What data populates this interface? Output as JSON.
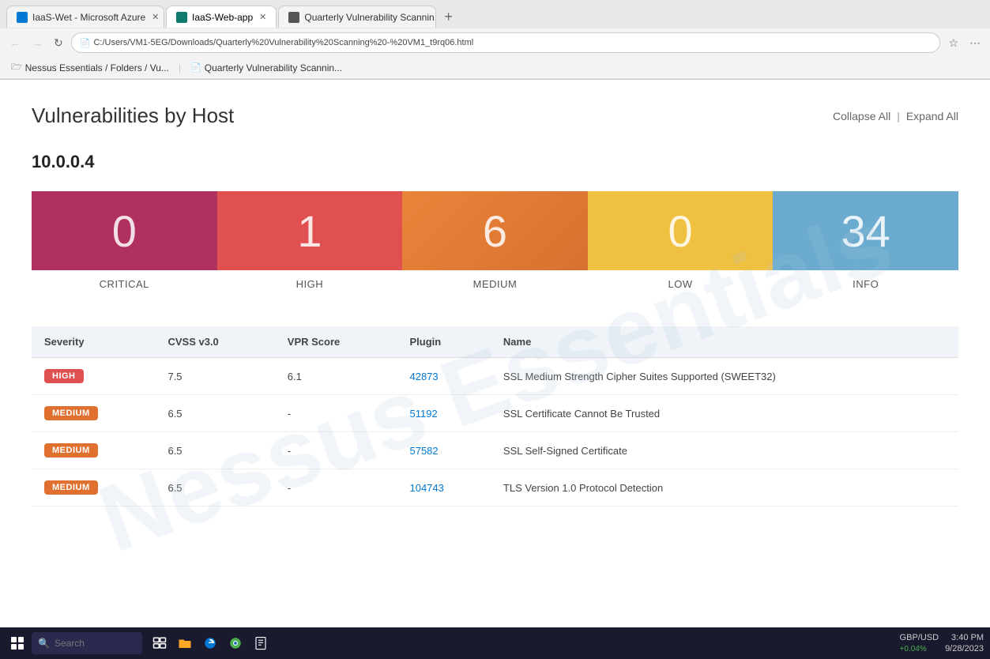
{
  "browser": {
    "tabs": [
      {
        "id": 1,
        "label": "IaaS-Wet - Microsoft Azure",
        "active": false,
        "icon": "azure"
      },
      {
        "id": 2,
        "label": "IaaS-Web-app",
        "active": true,
        "icon": "edge"
      },
      {
        "id": 3,
        "label": "Quarterly Vulnerability Scannin...",
        "active": false,
        "icon": "file"
      }
    ],
    "url": "C:/Users/VM1-5EG/Downloads/Quarterly%20Vulnerability%20Scanning%20-%20VM1_t9rq06.html",
    "url_display": "C:/Users/VM1-5EG/Downloads/Quarterly%20Vulnerability%20Scanning%20-%20VM1_t9rq06.html",
    "bookmarks": [
      {
        "label": "Nessus Essentials / Folders / Vu...",
        "icon": "🗁"
      },
      {
        "label": "Quarterly Vulnerability Scannin...",
        "icon": "📄"
      }
    ]
  },
  "page": {
    "title": "Vulnerabilities by Host",
    "collapse_all": "Collapse All",
    "expand_all": "Expand All",
    "separator": "|",
    "watermark": "Nessus Ess..."
  },
  "host": {
    "ip": "10.0.0.4"
  },
  "severity_cards": [
    {
      "id": "critical",
      "count": "0",
      "label": "CRITICAL",
      "class": "card-critical"
    },
    {
      "id": "high",
      "count": "1",
      "label": "HIGH",
      "class": "card-high"
    },
    {
      "id": "medium",
      "count": "6",
      "label": "MEDIUM",
      "class": "card-medium"
    },
    {
      "id": "low",
      "count": "0",
      "label": "LOW",
      "class": "card-low"
    },
    {
      "id": "info",
      "count": "34",
      "label": "INFO",
      "class": "card-info"
    }
  ],
  "table": {
    "headers": [
      "Severity",
      "CVSS v3.0",
      "VPR Score",
      "Plugin",
      "Name"
    ],
    "rows": [
      {
        "severity": "HIGH",
        "severity_class": "badge-high",
        "cvss": "7.5",
        "vpr": "6.1",
        "plugin": "42873",
        "name": "SSL Medium Strength Cipher Suites Supported (SWEET32)"
      },
      {
        "severity": "MEDIUM",
        "severity_class": "badge-medium",
        "cvss": "6.5",
        "vpr": "-",
        "plugin": "51192",
        "name": "SSL Certificate Cannot Be Trusted"
      },
      {
        "severity": "MEDIUM",
        "severity_class": "badge-medium",
        "cvss": "6.5",
        "vpr": "-",
        "plugin": "57582",
        "name": "SSL Self-Signed Certificate"
      },
      {
        "severity": "MEDIUM",
        "severity_class": "badge-medium",
        "cvss": "6.5",
        "vpr": "-",
        "plugin": "104743",
        "name": "TLS Version 1.0 Protocol Detection"
      }
    ]
  },
  "taskbar": {
    "search_placeholder": "Search",
    "time": "3:40 PM",
    "date": "9/28/2023",
    "currency_symbol": "GBP/USD",
    "currency_value": "+0.04%"
  }
}
